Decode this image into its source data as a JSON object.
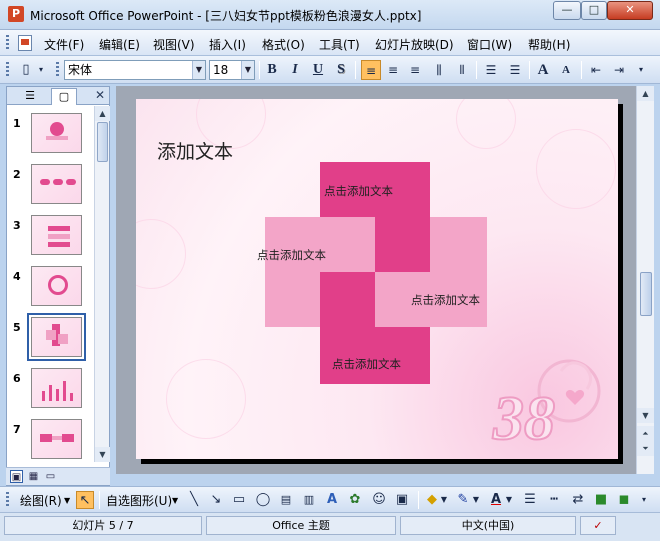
{
  "window": {
    "title": "Microsoft Office PowerPoint - [三八妇女节ppt模板粉色浪漫女人.pptx]",
    "min_glyph": "—",
    "max_glyph": "□",
    "close_glyph": "✕"
  },
  "menu": {
    "items": [
      "文件(F)",
      "编辑(E)",
      "视图(V)",
      "插入(I)",
      "格式(O)",
      "工具(T)",
      "幻灯片放映(D)",
      "窗口(W)",
      "帮助(H)"
    ]
  },
  "format_toolbar": {
    "font_name": "宋体",
    "font_size": "18",
    "bold": "B",
    "italic": "I",
    "underline": "U",
    "shadow": "S",
    "grow_font": "A",
    "shrink_font": "A",
    "align_left_icon": "align-left-icon",
    "align_left_active": true
  },
  "slides_pane": {
    "tab_outline_icon": "outline-icon",
    "tab_slides_icon": "slides-icon",
    "close_glyph": "✕",
    "thumbnails": [
      {
        "number": "1"
      },
      {
        "number": "2"
      },
      {
        "number": "3"
      },
      {
        "number": "4"
      },
      {
        "number": "5",
        "current": true
      },
      {
        "number": "6"
      },
      {
        "number": "7"
      }
    ]
  },
  "slide": {
    "title": "添加文本",
    "placeholders": [
      "点击添加文本",
      "点击添加文本",
      "点击添加文本",
      "点击添加文本"
    ],
    "logo_text": "38",
    "colors": {
      "dark_block": "#e13f89",
      "light_block": "#f3a5c8"
    }
  },
  "drawing_toolbar": {
    "draw_label": "绘图(R)",
    "autoshapes_label": "自选图形(U)"
  },
  "status": {
    "slide_info": "幻灯片 5 / 7",
    "theme": "Office 主题",
    "language": "中文(中国)"
  }
}
